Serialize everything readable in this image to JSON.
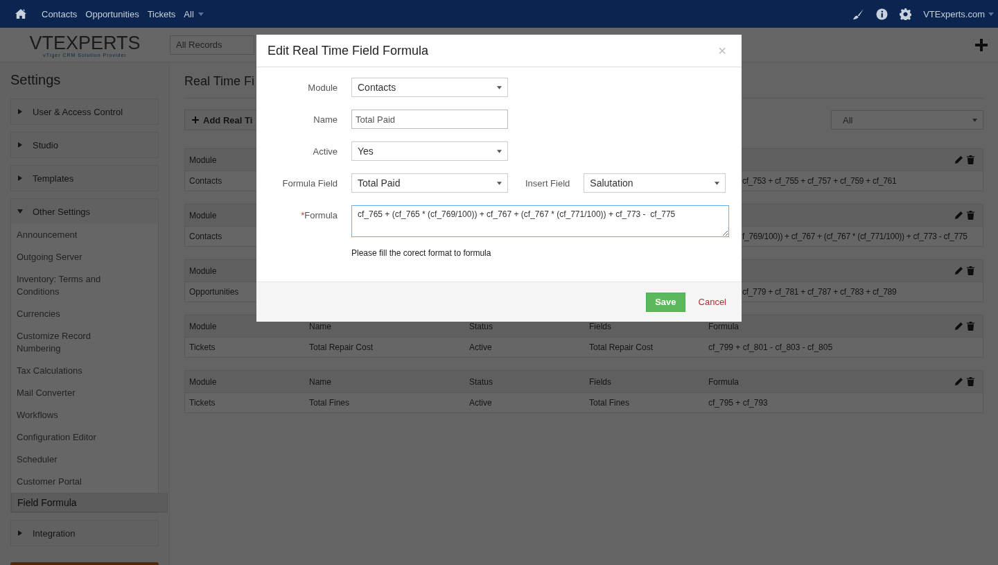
{
  "nav": {
    "items": [
      {
        "label": "Contacts",
        "dropdown": false
      },
      {
        "label": "Opportunities",
        "dropdown": false
      },
      {
        "label": "Tickets",
        "dropdown": false
      },
      {
        "label": "All",
        "dropdown": true
      }
    ],
    "user": "VTExperts.com"
  },
  "logo": {
    "name": "VTEXPERTS",
    "tagline": "vTiger CRM Solution Provider"
  },
  "record_filter": "All Records",
  "sidebar": {
    "title": "Settings",
    "groups": [
      {
        "label": "User & Access Control",
        "expanded": false
      },
      {
        "label": "Studio",
        "expanded": false
      },
      {
        "label": "Templates",
        "expanded": false
      },
      {
        "label": "Other Settings",
        "expanded": true,
        "items": [
          {
            "label": "Announcement",
            "selected": false
          },
          {
            "label": "Outgoing Server",
            "selected": false
          },
          {
            "label": "Inventory: Terms and Conditions",
            "selected": false
          },
          {
            "label": "Currencies",
            "selected": false
          },
          {
            "label": "Customize Record Numbering",
            "selected": false
          },
          {
            "label": "Tax Calculations",
            "selected": false
          },
          {
            "label": "Mail Converter",
            "selected": false
          },
          {
            "label": "Workflows",
            "selected": false
          },
          {
            "label": "Configuration Editor",
            "selected": false
          },
          {
            "label": "Scheduler",
            "selected": false
          },
          {
            "label": "Customer Portal",
            "selected": false
          },
          {
            "label": "Field Formula",
            "selected": true
          }
        ]
      },
      {
        "label": "Integration",
        "expanded": false
      }
    ]
  },
  "page": {
    "title": "Real Time Fi",
    "add_button": "Add Real Ti",
    "filter": "All"
  },
  "records": [
    {
      "kind": "partial",
      "headers": [
        "Module"
      ],
      "values": [
        "Contacts",
        "cf_753 + cf_755 + cf_757 + cf_759 + cf_761"
      ]
    },
    {
      "kind": "partial",
      "headers": [
        "Module"
      ],
      "values": [
        "Contacts",
        "f_769/100)) + cf_767 + (cf_767 * (cf_771/100)) + cf_773 - cf_775"
      ]
    },
    {
      "kind": "partial",
      "headers": [
        "Module"
      ],
      "values": [
        "Opportunities",
        "cf_779 + cf_781 + cf_787 + cf_783 + cf_789"
      ]
    },
    {
      "kind": "full",
      "headers": [
        "Module",
        "Name",
        "Status",
        "Fields",
        "Formula"
      ],
      "values": [
        "Tickets",
        "Total Repair Cost",
        "Active",
        "Total Repair Cost",
        "cf_799 + cf_801 - cf_803 - cf_805"
      ]
    },
    {
      "kind": "full",
      "headers": [
        "Module",
        "Name",
        "Status",
        "Fields",
        "Formula"
      ],
      "values": [
        "Tickets",
        "Total Fines",
        "Active",
        "Total Fines",
        "cf_795 + cf_793"
      ]
    }
  ],
  "modal": {
    "title": "Edit Real Time Field Formula",
    "close": "×",
    "rows": [
      {
        "kind": "select",
        "label": "Module",
        "value": "Contacts"
      },
      {
        "kind": "text",
        "label": "Name",
        "value": "Total Paid"
      },
      {
        "kind": "select",
        "label": "Active",
        "value": "Yes"
      },
      {
        "kind": "pair",
        "label": "Formula Field",
        "value": "Total Paid",
        "label2": "Insert Field",
        "value2": "Salutation"
      },
      {
        "kind": "textarea",
        "label": "Formula",
        "required": true,
        "required_mark": "*",
        "value": "cf_765 + (cf_765 * (cf_769/100)) + cf_767 + (cf_767 * (cf_771/100)) + cf_773 -  cf_775"
      }
    ],
    "help": "Please fill the corect format to formula",
    "save": "Save",
    "cancel": "Cancel"
  }
}
